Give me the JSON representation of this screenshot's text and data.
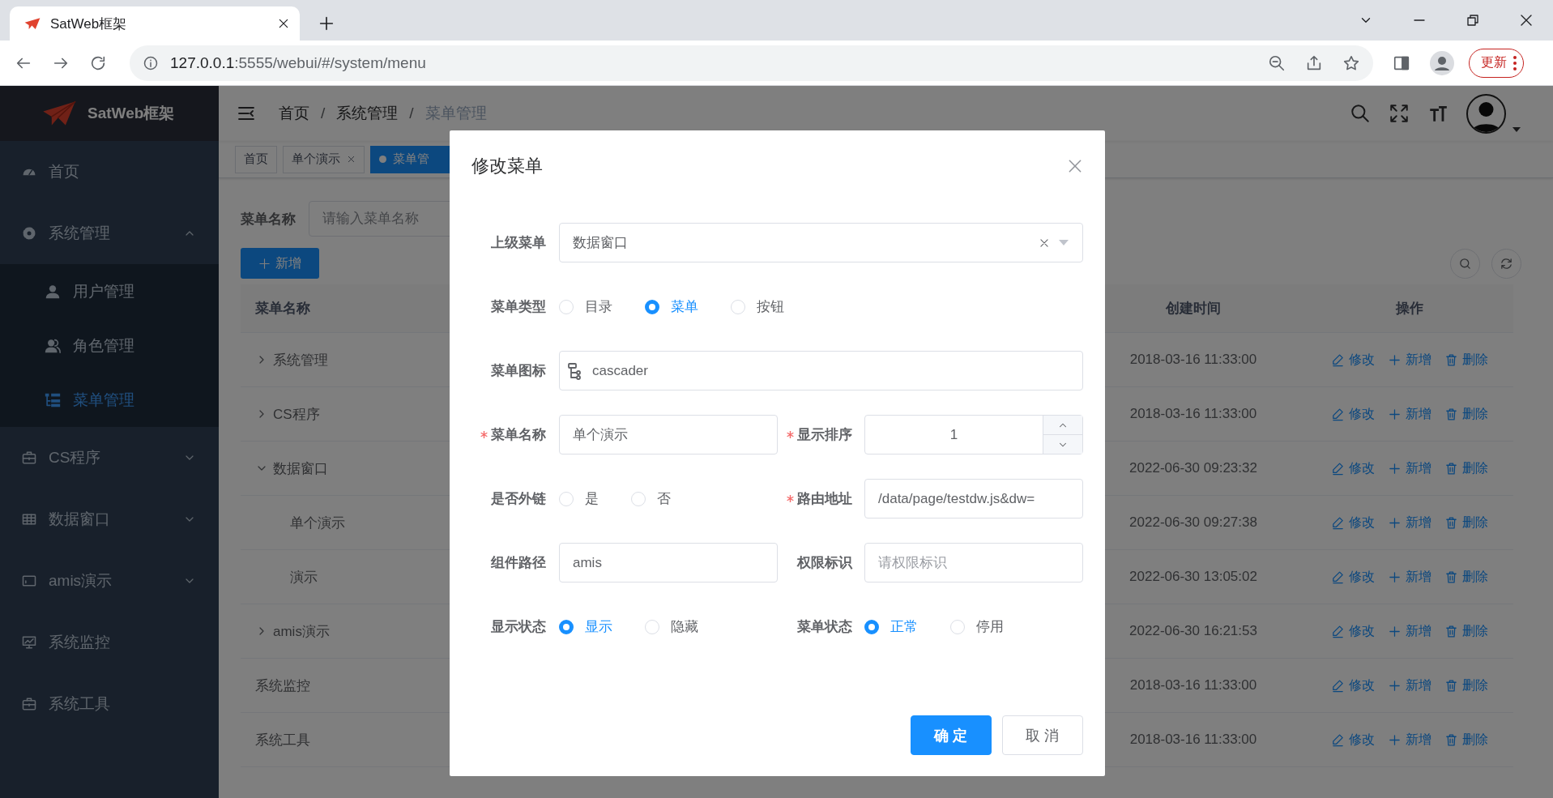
{
  "browser": {
    "tab_title": "SatWeb框架",
    "url_host": "127.0.0.1",
    "url_path": ":5555/webui/#/system/menu",
    "update_label": "更新"
  },
  "sidebar": {
    "logo_text": "SatWeb框架",
    "items": [
      {
        "label": "首页",
        "selected": false
      },
      {
        "label": "系统管理",
        "selected": false,
        "expanded": true,
        "children": [
          {
            "label": "用户管理",
            "selected": false
          },
          {
            "label": "角色管理",
            "selected": false
          },
          {
            "label": "菜单管理",
            "selected": true
          }
        ]
      },
      {
        "label": "CS程序",
        "selected": false,
        "expanded": false
      },
      {
        "label": "数据窗口",
        "selected": false,
        "expanded": false
      },
      {
        "label": "amis演示",
        "selected": false,
        "expanded": false
      },
      {
        "label": "系统监控",
        "selected": false
      },
      {
        "label": "系统工具",
        "selected": false
      }
    ]
  },
  "header": {
    "breadcrumb": [
      {
        "label": "首页"
      },
      {
        "separator": "/",
        "label": "系统管理"
      },
      {
        "separator": "/",
        "label": "菜单管理"
      }
    ]
  },
  "tags": [
    {
      "label": "首页",
      "selected": false,
      "closable": false
    },
    {
      "label": "单个演示",
      "selected": false,
      "closable": true
    },
    {
      "label": "菜单管",
      "selected": true,
      "closable": false
    }
  ],
  "search": {
    "label": "菜单名称",
    "placeholder": "请输入菜单名称"
  },
  "add_button": "新增",
  "table": {
    "columns": [
      "菜单名称",
      "创建时间",
      "操作"
    ],
    "rows": [
      {
        "name": "系统管理",
        "expanded": false,
        "created": "2018-03-16 11:33:00",
        "actions": [
          "修改",
          "新增",
          "删除"
        ]
      },
      {
        "name": "CS程序",
        "expanded": false,
        "created": "2018-03-16 11:33:00",
        "actions": [
          "修改",
          "新增",
          "删除"
        ]
      },
      {
        "name": "数据窗口",
        "expanded": true,
        "created": "2022-06-30 09:23:32",
        "actions": [
          "修改",
          "新增",
          "删除"
        ],
        "children": [
          {
            "name": "单个演示",
            "created": "2022-06-30 09:27:38",
            "actions": [
              "修改",
              "新增",
              "删除"
            ]
          },
          {
            "name": "演示",
            "created": "2022-06-30 13:05:02",
            "actions": [
              "修改",
              "新增",
              "删除"
            ]
          }
        ]
      },
      {
        "name": "amis演示",
        "expanded": false,
        "created": "2022-06-30 16:21:53",
        "actions": [
          "修改",
          "新增",
          "删除"
        ]
      },
      {
        "name": "系统监控",
        "created": "2018-03-16 11:33:00",
        "actions": [
          "修改",
          "新增",
          "删除"
        ]
      },
      {
        "name": "系统工具",
        "created": "2018-03-16 11:33:00",
        "actions": [
          "修改",
          "新增",
          "删除"
        ]
      }
    ]
  },
  "dialog": {
    "title": "修改菜单",
    "rows": [
      [
        {
          "kind": "select",
          "label": "上级菜单",
          "required": false,
          "value": "数据窗口"
        }
      ],
      [
        {
          "kind": "radio",
          "label": "菜单类型",
          "required": false,
          "options": [
            {
              "label": "目录",
              "selected": false
            },
            {
              "label": "菜单",
              "selected": true
            },
            {
              "label": "按钮",
              "selected": false
            }
          ]
        }
      ],
      [
        {
          "kind": "icon-input",
          "label": "菜单图标",
          "required": false,
          "value": "cascader"
        }
      ],
      [
        {
          "kind": "input",
          "label": "菜单名称",
          "required": true,
          "value": "单个演示"
        },
        {
          "kind": "number",
          "label": "显示排序",
          "required": true,
          "value": "1"
        }
      ],
      [
        {
          "kind": "radio",
          "label": "是否外链",
          "required": false,
          "options": [
            {
              "label": "是",
              "selected": false
            },
            {
              "label": "否",
              "selected": false
            }
          ]
        },
        {
          "kind": "input",
          "label": "路由地址",
          "required": true,
          "value": "/data/page/testdw.js&dw="
        }
      ],
      [
        {
          "kind": "input",
          "label": "组件路径",
          "required": false,
          "value": "amis"
        },
        {
          "kind": "input",
          "label": "权限标识",
          "required": false,
          "placeholder": "请权限标识"
        }
      ],
      [
        {
          "kind": "radio",
          "label": "显示状态",
          "required": false,
          "options": [
            {
              "label": "显示",
              "selected": true
            },
            {
              "label": "隐藏",
              "selected": false
            }
          ]
        },
        {
          "kind": "radio",
          "label": "菜单状态",
          "required": false,
          "options": [
            {
              "label": "正常",
              "selected": true
            },
            {
              "label": "停用",
              "selected": false
            }
          ]
        }
      ]
    ],
    "buttons": [
      {
        "label": "确 定",
        "kind": "primary"
      },
      {
        "label": "取 消",
        "kind": "default"
      }
    ]
  }
}
